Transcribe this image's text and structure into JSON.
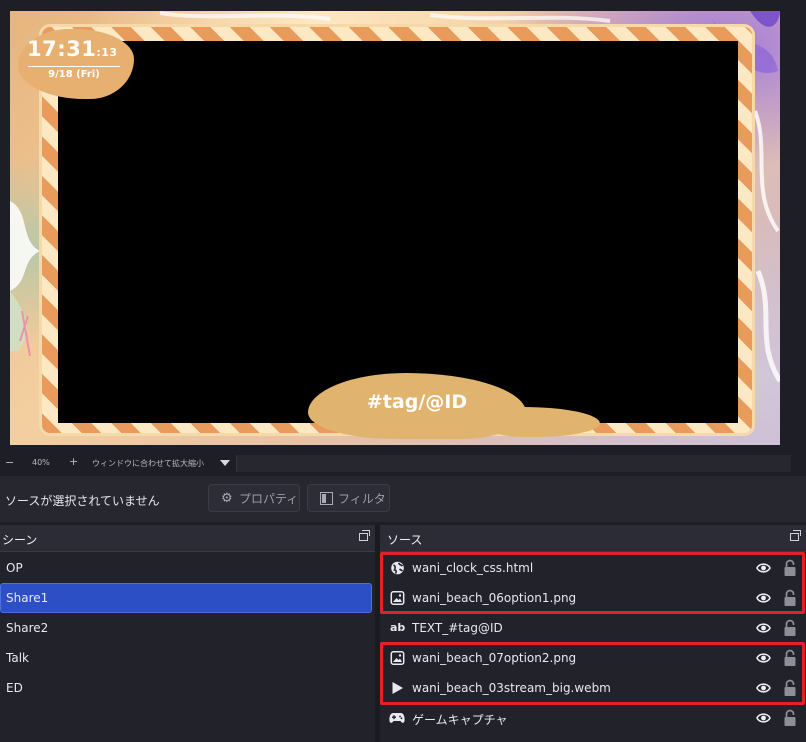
{
  "preview": {
    "clock_time": "17:31",
    "clock_seconds": ":13",
    "clock_date": "9/18 (Fri)",
    "tag_text": "#tag/@ID"
  },
  "zoom_bar": {
    "minus": "−",
    "level": "40%",
    "plus": "+",
    "fit_label": "ウィンドウに合わせて拡大縮小"
  },
  "source_toolbar": {
    "status": "ソースが選択されていません",
    "properties_label": "プロパティ",
    "filters_label": "フィルタ"
  },
  "scenes": {
    "title": "シーン",
    "items": [
      {
        "label": "OP",
        "selected": false
      },
      {
        "label": "Share1",
        "selected": true
      },
      {
        "label": "Share2",
        "selected": false
      },
      {
        "label": "Talk",
        "selected": false
      },
      {
        "label": "ED",
        "selected": false
      }
    ]
  },
  "sources": {
    "title": "ソース",
    "items": [
      {
        "label": "wani_clock_css.html",
        "icon": "globe-icon",
        "visible": true,
        "locked": true
      },
      {
        "label": "wani_beach_06option1.png",
        "icon": "image-icon",
        "visible": true,
        "locked": true
      },
      {
        "label": "TEXT_#tag@ID",
        "icon": "text-icon",
        "icon_text": "ab",
        "visible": true,
        "locked": true
      },
      {
        "label": "wani_beach_07option2.png",
        "icon": "image-icon",
        "visible": true,
        "locked": true
      },
      {
        "label": "wani_beach_03stream_big.webm",
        "icon": "play-icon",
        "visible": true,
        "locked": true
      },
      {
        "label": "ゲームキャプチャ",
        "icon": "gamepad-icon",
        "visible": true,
        "locked": true
      }
    ]
  },
  "colors": {
    "selection": "#2c4fc5",
    "highlight_box": "#e5202a",
    "background": "#1e1f26"
  }
}
